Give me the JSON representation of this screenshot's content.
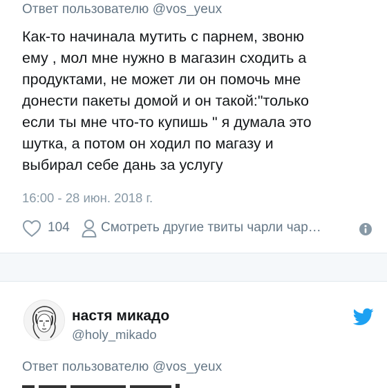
{
  "tweet1": {
    "reply_prefix": "Ответ пользователю",
    "reply_handle": "@vos_yeux",
    "text_lines": [
      "Как-то начинала мутить с парнем, звоню",
      "ему , мол мне нужно в магазин сходить а",
      "продуктами, не может ли он помочь мне",
      "донести пакеты домой и он такой:\"только",
      "если ты мне что-то купишь \" я думала это",
      "шутка, а потом он ходил по магазу и",
      "выбирал себе дань за услугу"
    ],
    "timestamp": "16:00 - 28 июн. 2018 г.",
    "like_count": "104",
    "more_tweets_label": "Смотреть другие твиты чарли чар…",
    "like_icon": "heart-outline-icon",
    "person_icon": "person-outline-icon",
    "info_icon": "info-icon"
  },
  "tweet2": {
    "display_name": "настя микадо",
    "handle": "@holy_mikado",
    "reply_prefix": "Ответ пользователю",
    "reply_handle": "@vos_yeux",
    "avatar_icon": "avatar-sketch",
    "brand_icon": "twitter-bird-icon"
  },
  "colors": {
    "text": "#14171a",
    "secondary": "#657786",
    "timestamp": "#8899a6",
    "twitter_blue": "#1da1f2",
    "divider_bg": "#f5f8fa"
  }
}
